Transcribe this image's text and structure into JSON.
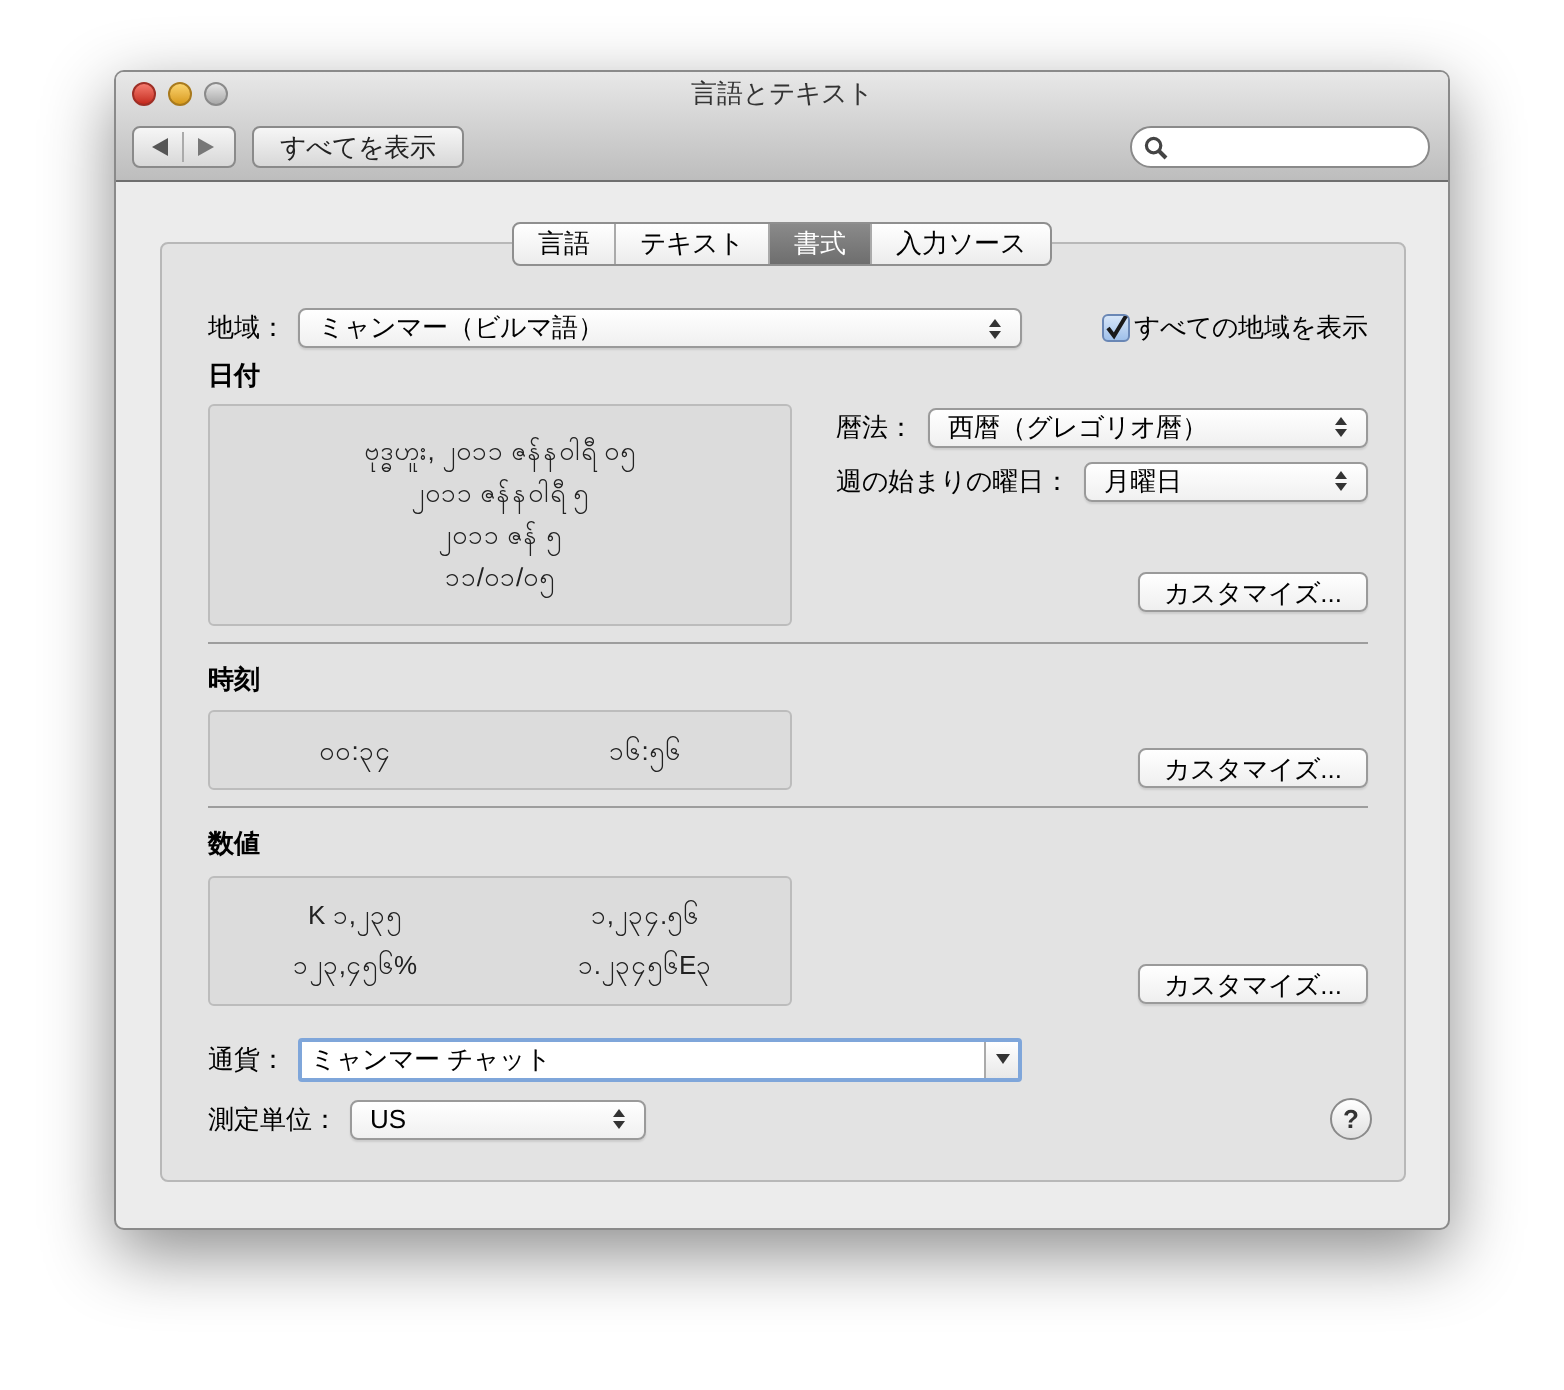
{
  "window": {
    "title": "言語とテキスト"
  },
  "toolbar": {
    "show_all": "すべてを表示"
  },
  "tabs": [
    {
      "label": "言語",
      "selected": false
    },
    {
      "label": "テキスト",
      "selected": false
    },
    {
      "label": "書式",
      "selected": true
    },
    {
      "label": "入力ソース",
      "selected": false
    }
  ],
  "region": {
    "label": "地域：",
    "value": "ミャンマー（ビルマ語）",
    "show_all_regions": {
      "label": "すべての地域を表示",
      "checked": true
    }
  },
  "dates": {
    "heading": "日付",
    "examples": [
      "ဗုဒ္ဓဟူး, ၂၀၁၁ ဇန်နဝါရီ ၀၅",
      "၂၀၁၁ ဇန်နဝါရီ ၅",
      "၂၀၁၁ ဇန် ၅",
      "၁၁/၀၁/၀၅"
    ],
    "calendar": {
      "label": "暦法：",
      "value": "西暦（グレゴリオ暦）"
    },
    "first_day": {
      "label": "週の始まりの曜日：",
      "value": "月曜日"
    },
    "customize": "カスタマイズ..."
  },
  "times": {
    "heading": "時刻",
    "examples": [
      "၀၀:၃၄",
      "၁၆:၅၆"
    ],
    "customize": "カスタマイズ..."
  },
  "numbers": {
    "heading": "数値",
    "examples": [
      "K ၁,၂၃၅",
      "၁,၂၃၄.၅၆",
      "၁၂၃,၄၅၆%",
      "၁.၂၃၄၅၆E၃"
    ],
    "customize": "カスタマイズ..."
  },
  "currency": {
    "label": "通貨：",
    "value": "ミャンマー チャット"
  },
  "measurement": {
    "label": "測定単位：",
    "value": "US"
  },
  "help": "?"
}
